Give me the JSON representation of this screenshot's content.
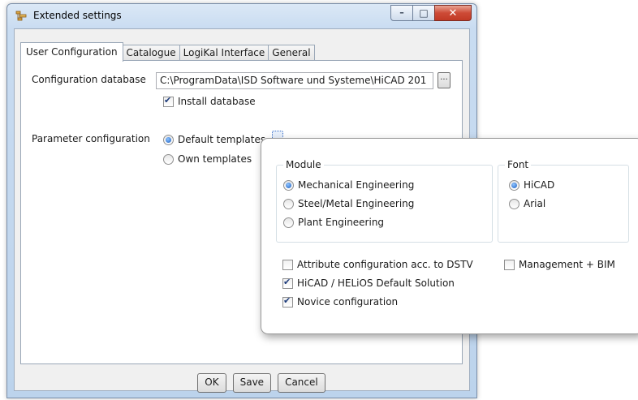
{
  "window": {
    "title": "Extended settings",
    "minimize_glyph": "–",
    "maximize_glyph": "□",
    "close_glyph": "✕"
  },
  "tabs": [
    {
      "label": "User Configuration",
      "active": true
    },
    {
      "label": "Catalogue",
      "active": false
    },
    {
      "label": "LogiKal Interface",
      "active": false
    },
    {
      "label": "General",
      "active": false
    }
  ],
  "user_config": {
    "config_db_label": "Configuration database",
    "config_db_path": "C:\\ProgramData\\ISD Software und Systeme\\HiCAD 201",
    "browse_label": "...",
    "install_db_label": "Install database",
    "install_db_checked": true,
    "param_config_label": "Parameter configuration",
    "default_templates_label": "Default templates",
    "default_templates_selected": true,
    "own_templates_label": "Own templates",
    "own_templates_selected": false
  },
  "popup": {
    "module": {
      "title": "Module",
      "options": [
        {
          "label": "Mechanical Engineering",
          "selected": true
        },
        {
          "label": "Steel/Metal Engineering",
          "selected": false
        },
        {
          "label": "Plant Engineering",
          "selected": false
        }
      ]
    },
    "font": {
      "title": "Font",
      "options": [
        {
          "label": "HiCAD",
          "selected": true
        },
        {
          "label": "Arial",
          "selected": false
        }
      ]
    },
    "checkboxes": {
      "attribute_dstv": {
        "label": "Attribute configuration acc. to DSTV",
        "checked": false
      },
      "management_bim": {
        "label": "Management + BIM",
        "checked": false
      },
      "helios_default": {
        "label": "HiCAD / HELiOS Default Solution",
        "checked": true
      },
      "novice": {
        "label": "Novice configuration",
        "checked": true
      }
    }
  },
  "footer": {
    "ok": "OK",
    "save": "Save",
    "cancel": "Cancel"
  },
  "colors": {
    "titlebar": "#c9dcf1",
    "close_button": "#cd4a36",
    "radio_dot": "#1c5fc1"
  }
}
